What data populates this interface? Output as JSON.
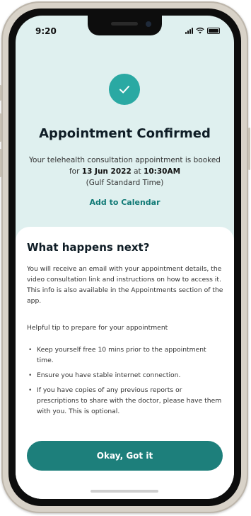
{
  "status_bar": {
    "time": "9:20",
    "icons": [
      "cellular-signal-icon",
      "wifi-icon",
      "battery-icon"
    ]
  },
  "confirmation": {
    "icon": "checkmark-icon",
    "title": "Appointment Confirmed",
    "desc_prefix": "Your telehealth consultation appointment is booked for ",
    "date": "13 Jun 2022",
    "desc_mid": " at ",
    "time": "10:30AM",
    "timezone": "(Gulf Standard Time)",
    "add_to_calendar": "Add to Calendar"
  },
  "next_steps": {
    "title": "What happens next?",
    "body": "You will receive an email with your appointment details, the video consultation link and instructions on how to access it. This info is also available in the Appointments section of the app.",
    "tip_heading": "Helpful tip to prepare for your appointment",
    "tips": [
      "Keep yourself free 10 mins prior to the appointment time.",
      "Ensure you have stable internet connection.",
      "If you have copies of any previous reports or prescriptions to share with the doctor, please have them with you. This is optional."
    ]
  },
  "actions": {
    "okay_label": "Okay, Got it"
  },
  "colors": {
    "accent": "#2aa9a3",
    "button": "#1d7f7b",
    "link": "#117a76",
    "header_bg": "#dff0ef"
  }
}
